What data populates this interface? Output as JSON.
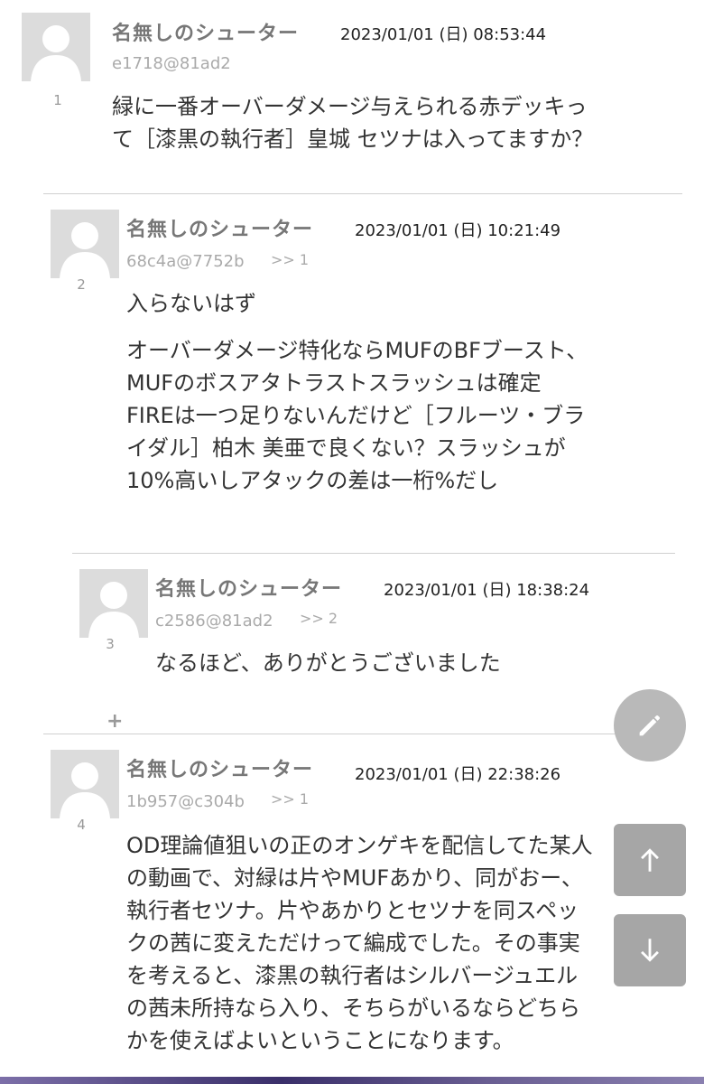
{
  "posts": [
    {
      "number": "1",
      "name": "名無しのシューター",
      "date": "2023/01/01 (日) 08:53:44",
      "id": "e1718@81ad2",
      "reply_to": "",
      "body": [
        "緑に一番オーバーダメージ与えられる赤デッキっ",
        "て［漆黒の執行者］皇城 セツナは入ってますか？"
      ]
    },
    {
      "number": "2",
      "name": "名無しのシューター",
      "date": "2023/01/01 (日) 10:21:49",
      "id": "68c4a@7752b",
      "reply_to": ">> 1",
      "body_p1": "入らないはず",
      "body_p2": [
        "オーバーダメージ特化ならMUFのBFブースト、",
        "MUFのボスアタトラストスラッシュは確定",
        "FIREは一つ足りないんだけど［フルーツ・ブラ",
        "イダル］柏木 美亜で良くない？スラッシュが",
        "10%高いしアタックの差は一桁%だし"
      ]
    },
    {
      "number": "3",
      "name": "名無しのシューター",
      "date": "2023/01/01 (日) 18:38:24",
      "id": "c2586@81ad2",
      "reply_to": ">> 2",
      "body": [
        "なるほど、ありがとうございました"
      ]
    },
    {
      "number": "4",
      "name": "名無しのシューター",
      "date": "2023/01/01 (日) 22:38:26",
      "id": "1b957@c304b",
      "reply_to": ">> 1",
      "body": [
        "OD理論値狙いの正のオンゲキを配信してた某人",
        "の動画で、対緑は片やMUFあかり、同がおー、",
        "執行者セツナ。片やあかりとセツナを同スペッ",
        "クの茜に変えただけって編成でした。その事実",
        "を考えると、漆黒の執行者はシルバージュエル",
        "の茜未所持なら入り、そちらがいるならどちら",
        "かを使えばよいということになります。"
      ]
    }
  ],
  "expand_label": "+",
  "icons": {
    "avatar": "default-user-avatar-icon",
    "edit": "pencil-icon",
    "up": "arrow-up-icon",
    "down": "arrow-down-icon"
  },
  "colors": {
    "avatar_bg": "#dcdcdc",
    "name": "#777777",
    "fab": "#b9b9b9"
  }
}
